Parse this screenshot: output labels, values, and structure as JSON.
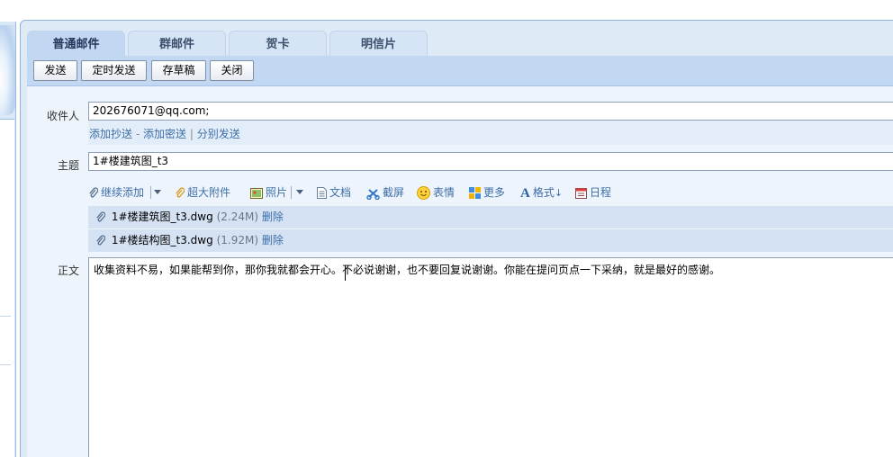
{
  "tabs": [
    "普通邮件",
    "群邮件",
    "贺卡",
    "明信片"
  ],
  "toolbar": {
    "send": "发送",
    "schedule": "定时发送",
    "draft": "存草稿",
    "close": "关闭"
  },
  "recipient": {
    "label": "收件人",
    "value": "202676071@qq.com;",
    "links": {
      "cc": "添加抄送",
      "dash": "-",
      "bcc": "添加密送",
      "bar": "|",
      "separate": "分别发送"
    }
  },
  "subject": {
    "label": "主题",
    "value": "1#楼建筑图_t3"
  },
  "attach_toolbar": {
    "continue_add": "继续添加",
    "huge_attachment": "超大附件",
    "photo": "照片",
    "document": "文档",
    "screenshot": "截屏",
    "emoji": "表情",
    "more": "更多",
    "format": "格式",
    "schedule": "日程"
  },
  "attachments": [
    {
      "name": "1#楼建筑图_t3.dwg",
      "size": "(2.24M)",
      "delete": "删除"
    },
    {
      "name": "1#楼结构图_t3.dwg",
      "size": "(1.92M)",
      "delete": "删除"
    }
  ],
  "body": {
    "label": "正文",
    "text": "收集资料不易，如果能帮到你，那你我就都会开心。不必说谢谢，也不要回复说谢谢。你能在提问页点一下采纳，就是最好的感谢。"
  },
  "icons": {
    "paperclip": "paperclip-icon",
    "photo": "photo-icon",
    "document": "document-icon",
    "screenshot": "scissors-icon",
    "emoji": "smiley-icon",
    "more": "grid-icon",
    "format": "font-icon",
    "calendar": "calendar-icon"
  },
  "colors": {
    "accent": "#c2d8f2",
    "link": "#3d6ea8",
    "frame_border": "#8fb2dd"
  }
}
